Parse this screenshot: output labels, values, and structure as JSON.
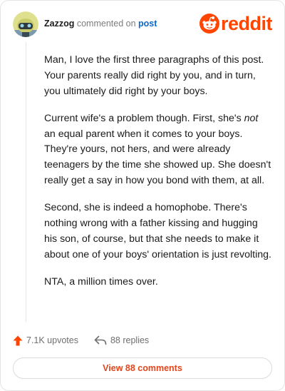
{
  "comment": {
    "username": "Zazzog",
    "action_text": "commented on",
    "post_link": "post",
    "avatar_icon": "snoo-avatar-icon"
  },
  "brand": {
    "logo_icon": "reddit-snoo-icon",
    "wordmark": "reddit",
    "color": "#ff4500"
  },
  "body": {
    "p1": "Man, I love the first three paragraphs of this post. Your parents really did right by you, and in turn, you ultimately did right by your boys.",
    "p2_before": "Current wife's a problem though. First, she's ",
    "p2_em": "not",
    "p2_after": " an equal parent when it comes to your boys. They're yours, not hers, and were already teenagers by the time she showed up. She doesn't really get a say in how you bond with them, at all.",
    "p3": "Second, she is indeed a homophobe. There's nothing wrong with a father kissing and hugging his son, of course, but that she needs to make it about one of your boys' orientation is just revolting.",
    "p4": "NTA, a million times over."
  },
  "stats": {
    "upvotes": "7.1K upvotes",
    "replies": "88 replies",
    "upvote_icon": "upvote-arrow-icon",
    "reply_icon": "reply-arrow-icon"
  },
  "footer": {
    "view_comments": "View 88 comments"
  }
}
